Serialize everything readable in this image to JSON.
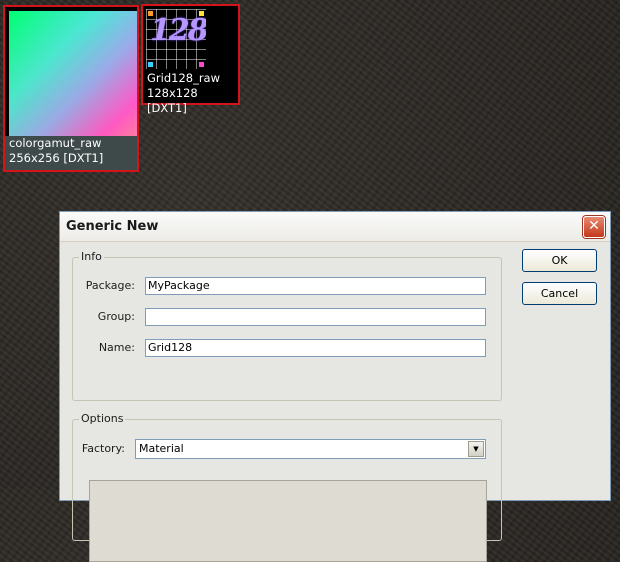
{
  "thumbnails": [
    {
      "name": "colorgamut_raw",
      "info": "256x256 [DXT1]"
    },
    {
      "name": "Grid128_raw",
      "info": "128x128 [DXT1]",
      "glyph": "128"
    }
  ],
  "dialog": {
    "title": "Generic New",
    "close_icon": "close-icon",
    "info_legend": "Info",
    "package_label": "Package:",
    "package_value": "MyPackage",
    "group_label": "Group:",
    "group_value": "",
    "name_label": "Name:",
    "name_value": "Grid128",
    "options_legend": "Options",
    "factory_label": "Factory:",
    "factory_value": "Material",
    "ok_label": "OK",
    "cancel_label": "Cancel"
  },
  "colors": {
    "selection_border": "#d4141b",
    "dialog_bg": "#e6e6e2",
    "close_button": "#c4381c"
  }
}
